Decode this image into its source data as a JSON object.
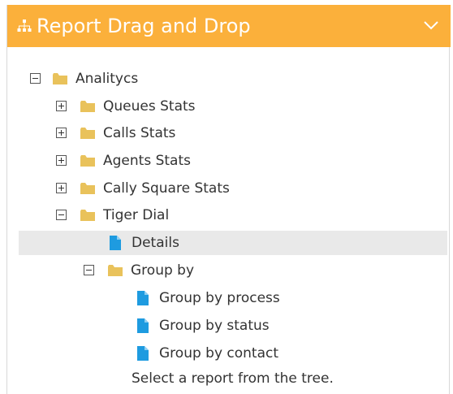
{
  "header": {
    "title": "Report Drag and Drop",
    "icon": "sitemap-icon",
    "collapse_icon": "chevron-down-icon",
    "color": "#fbb03b"
  },
  "tree": {
    "root": {
      "label": "Analitycs",
      "expanded": true
    },
    "items": [
      {
        "label": "Queues Stats",
        "expanded": false
      },
      {
        "label": "Calls Stats",
        "expanded": false
      },
      {
        "label": "Agents Stats",
        "expanded": false
      },
      {
        "label": "Cally Square Stats",
        "expanded": false
      },
      {
        "label": "Tiger Dial",
        "expanded": true
      }
    ],
    "tiger_dial": {
      "details": "Details",
      "group_by": {
        "label": "Group by",
        "expanded": true,
        "reports": [
          "Group by process",
          "Group by status",
          "Group by contact"
        ]
      }
    }
  },
  "status_text": "Select a report from the tree.",
  "colors": {
    "folder": "#e9c25b",
    "file": "#1e9be0",
    "selected_row": "#e9e9e9"
  }
}
